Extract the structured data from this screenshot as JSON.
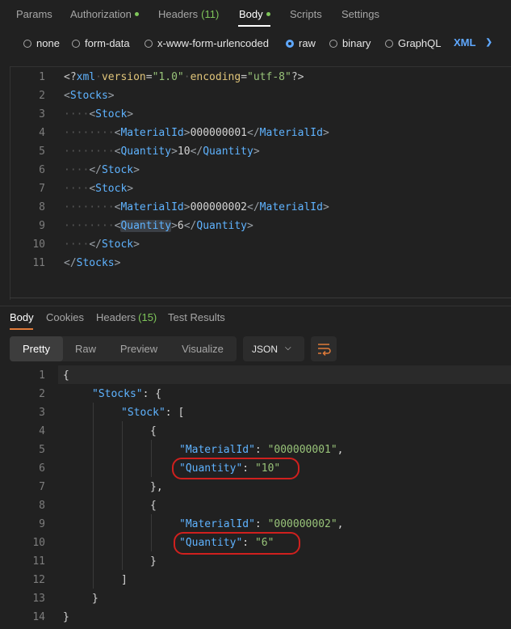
{
  "request_tabs": {
    "params": "Params",
    "authorization": "Authorization",
    "headers": "Headers",
    "headers_count": "(11)",
    "body": "Body",
    "scripts": "Scripts",
    "settings": "Settings"
  },
  "body_types": {
    "none": "none",
    "form_data": "form-data",
    "urlencoded": "x-www-form-urlencoded",
    "raw": "raw",
    "binary": "binary",
    "graphql": "GraphQL",
    "selected_format": "XML"
  },
  "request_body": {
    "line_numbers": [
      "1",
      "2",
      "3",
      "4",
      "5",
      "6",
      "7",
      "8",
      "9",
      "10",
      "11"
    ],
    "xml_decl": {
      "open": "<?",
      "name": "xml",
      "attr1": "version",
      "val1": "\"1.0\"",
      "attr2": "encoding",
      "val2": "\"utf-8\"",
      "close": "?>"
    },
    "stocks_tag": "Stocks",
    "stock_tag": "Stock",
    "materialid_tag": "MaterialId",
    "quantity_tag": "Quantity",
    "items": [
      {
        "materialid": "000000001",
        "quantity": "10"
      },
      {
        "materialid": "000000002",
        "quantity": "6"
      }
    ]
  },
  "response_tabs": {
    "body": "Body",
    "cookies": "Cookies",
    "headers": "Headers",
    "headers_count": "(15)",
    "test_results": "Test Results"
  },
  "view_modes": {
    "pretty": "Pretty",
    "raw": "Raw",
    "preview": "Preview",
    "visualize": "Visualize",
    "format": "JSON"
  },
  "response_body": {
    "line_numbers": [
      "1",
      "2",
      "3",
      "4",
      "5",
      "6",
      "7",
      "8",
      "9",
      "10",
      "11",
      "12",
      "13",
      "14"
    ],
    "stocks_key": "\"Stocks\"",
    "stock_key": "\"Stock\"",
    "materialid_key": "\"MaterialId\"",
    "quantity_key": "\"Quantity\"",
    "items": [
      {
        "materialid": "\"000000001\"",
        "quantity": "\"10\""
      },
      {
        "materialid": "\"000000002\"",
        "quantity": "\"6\""
      }
    ]
  },
  "colors": {
    "accent_blue": "#5fa8ff",
    "active_green": "#7fc65a",
    "tab_orange": "#e07b39",
    "annotation_red": "#d0201e"
  }
}
